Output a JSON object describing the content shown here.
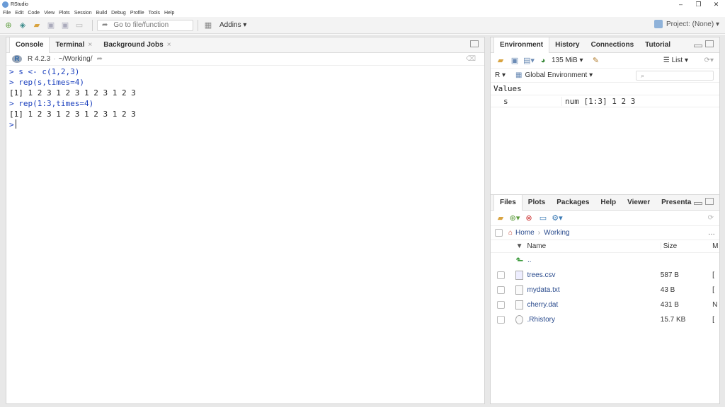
{
  "window": {
    "title": "RStudio"
  },
  "menu": [
    "File",
    "Edit",
    "Code",
    "View",
    "Plots",
    "Session",
    "Build",
    "Debug",
    "Profile",
    "Tools",
    "Help"
  ],
  "toolbar": {
    "goto_placeholder": "Go to file/function",
    "addins": "Addins",
    "project": "Project: (None)"
  },
  "console": {
    "tabs": [
      "Console",
      "Terminal",
      "Background Jobs"
    ],
    "version": "R 4.2.3",
    "path": "~/Working/",
    "lines": [
      {
        "type": "cmd",
        "text": "> s <- c(1,2,3)"
      },
      {
        "type": "cmd",
        "text": "> rep(s,times=4)"
      },
      {
        "type": "out",
        "text": " [1] 1 2 3 1 2 3 1 2 3 1 2 3"
      },
      {
        "type": "cmd",
        "text": "> rep(1:3,times=4)"
      },
      {
        "type": "out",
        "text": " [1] 1 2 3 1 2 3 1 2 3 1 2 3"
      }
    ],
    "prompt": ">"
  },
  "environment": {
    "tabs": [
      "Environment",
      "History",
      "Connections",
      "Tutorial"
    ],
    "memory": "135 MiB",
    "view_mode": "List",
    "lang": "R",
    "scope": "Global Environment",
    "section": "Values",
    "rows": [
      {
        "name": "s",
        "value": "num [1:3] 1 2 3"
      }
    ]
  },
  "files": {
    "tabs": [
      "Files",
      "Plots",
      "Packages",
      "Help",
      "Viewer",
      "Presenta"
    ],
    "breadcrumb": [
      "Home",
      "Working"
    ],
    "columns": {
      "name": "Name",
      "size": "Size",
      "modified": "M"
    },
    "parent": "..",
    "rows": [
      {
        "name": "trees.csv",
        "size": "587 B",
        "mod": "["
      },
      {
        "name": "mydata.txt",
        "size": "43 B",
        "mod": "["
      },
      {
        "name": "cherry.dat",
        "size": "431 B",
        "mod": "N"
      },
      {
        "name": ".Rhistory",
        "size": "15.7 KB",
        "mod": "["
      }
    ]
  }
}
